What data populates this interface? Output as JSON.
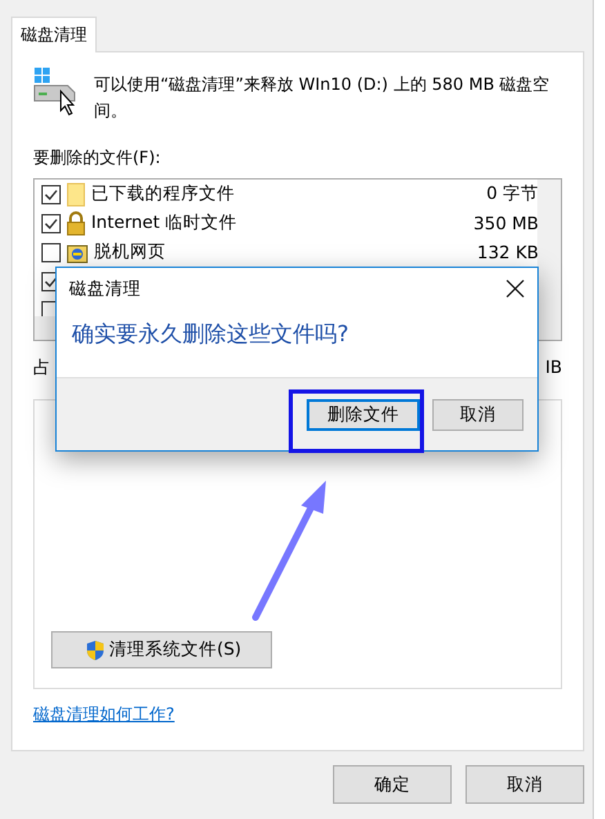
{
  "tab": {
    "label": "磁盘清理",
    "selected": true
  },
  "intro": "可以使用“磁盘清理”来释放 WIn10 (D:) 上的 580 MB 磁盘空间。",
  "files_label": "要删除的文件(F):",
  "files": [
    {
      "kind": "folder",
      "name": "已下载的程序文件",
      "size": "0 字节",
      "checked": true
    },
    {
      "kind": "lock",
      "name": "Internet 临时文件",
      "size": "350 MB",
      "checked": true
    },
    {
      "kind": "offline",
      "name": "脱机网页",
      "size": "132 KB",
      "checked": false
    },
    {
      "kind": "hidden",
      "checked": true
    },
    {
      "kind": "hidden",
      "checked": false
    }
  ],
  "space_line": {
    "start": "占",
    "end": "IB"
  },
  "system_button": "清理系统文件(S)",
  "help_link": "磁盘清理如何工作?",
  "buttons": [
    {
      "label": "确定"
    },
    {
      "label": "取消"
    }
  ],
  "dialog": {
    "title": "磁盘清理",
    "message": "确实要永久删除这些文件吗?",
    "buttons": [
      {
        "label": "删除文件",
        "selected": true
      },
      {
        "label": "取消",
        "selected": false
      }
    ]
  }
}
